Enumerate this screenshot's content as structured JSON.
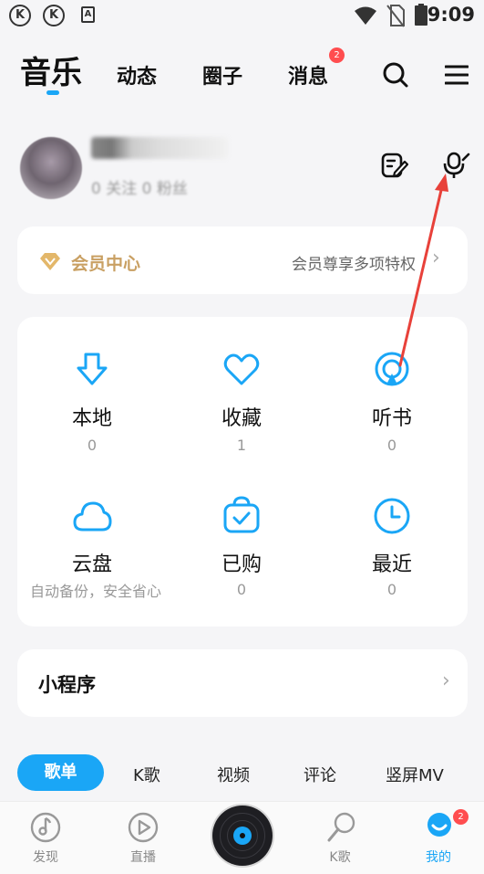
{
  "status_bar": {
    "left_icons": [
      "k-app-icon",
      "k-app-icon",
      "a-notification-icon"
    ],
    "right_icons": [
      "wifi-icon",
      "no-sim-icon",
      "battery-icon"
    ],
    "time": "9:09",
    "k_glyph": "K",
    "a_glyph": "A"
  },
  "top_tabs": [
    {
      "label": "音乐",
      "active": true
    },
    {
      "label": "动态"
    },
    {
      "label": "圈子"
    },
    {
      "label": "消息",
      "badge": "2"
    }
  ],
  "profile": {
    "stats_text": "0 关注   0 粉丝"
  },
  "vip": {
    "label": "会员中心",
    "desc": "会员尊享多项特权",
    "chevron": "›"
  },
  "grid": [
    {
      "icon": "download-icon",
      "label": "本地",
      "count": "0"
    },
    {
      "icon": "heart-icon",
      "label": "收藏",
      "count": "1"
    },
    {
      "icon": "audiobook-icon",
      "label": "听书",
      "count": "0"
    },
    {
      "icon": "cloud-icon",
      "label": "云盘",
      "sub": "自动备份，安全省心"
    },
    {
      "icon": "purchased-icon",
      "label": "已购",
      "count": "0"
    },
    {
      "icon": "clock-icon",
      "label": "最近",
      "count": "0"
    }
  ],
  "mini_program": {
    "label": "小程序",
    "chevron": "›"
  },
  "segments": [
    {
      "label": "歌单",
      "active": true
    },
    {
      "label": "K歌"
    },
    {
      "label": "视频"
    },
    {
      "label": "评论"
    },
    {
      "label": "竖屏MV"
    }
  ],
  "bottom_nav": [
    {
      "label": "发现",
      "icon": "music-note-icon"
    },
    {
      "label": "直播",
      "icon": "live-play-icon"
    },
    {
      "label": "",
      "icon": "vinyl-disc-icon"
    },
    {
      "label": "K歌",
      "icon": "microphone-icon"
    },
    {
      "label": "我的",
      "icon": "profile-icon",
      "badge": "2",
      "active": true
    }
  ],
  "colors": {
    "accent": "#1aa6f6",
    "vip_gold": "#c9a063",
    "badge_red": "#ff4d4f",
    "annotation_arrow": "#e8413a"
  }
}
